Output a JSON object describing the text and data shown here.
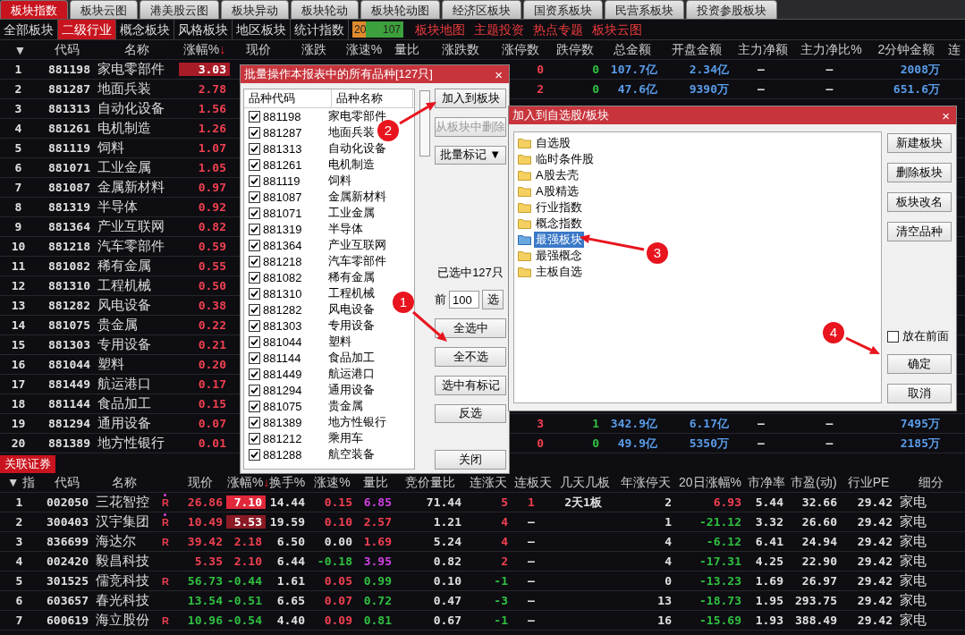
{
  "top_tabs": [
    {
      "label": "板块指数",
      "selected": true
    },
    {
      "label": "板块云图",
      "selected": false
    },
    {
      "label": "港美股云图",
      "selected": false
    },
    {
      "label": "板块异动",
      "selected": false
    },
    {
      "label": "板块轮动",
      "selected": false
    },
    {
      "label": "板块轮动图",
      "selected": false
    },
    {
      "label": "经济区板块",
      "selected": false
    },
    {
      "label": "国资系板块",
      "selected": false
    },
    {
      "label": "民营系板块",
      "selected": false
    },
    {
      "label": "投资参股板块",
      "selected": false
    }
  ],
  "sub_tabs": [
    {
      "label": "全部板块",
      "selected": false
    },
    {
      "label": "二级行业",
      "selected": true
    },
    {
      "label": "概念板块",
      "selected": false
    },
    {
      "label": "风格板块",
      "selected": false
    },
    {
      "label": "地区板块",
      "selected": false
    },
    {
      "label": "统计指数",
      "selected": false
    }
  ],
  "breadth": {
    "up": "20",
    "down": "107"
  },
  "links": [
    "板块地图",
    "主题投资",
    "热点专题",
    "板块云图"
  ],
  "sector_table": {
    "columns": [
      {
        "label": "▼",
        "sorted": false
      },
      {
        "label": "代码",
        "sorted": false
      },
      {
        "label": "名称",
        "sorted": false
      },
      {
        "label": "涨幅%",
        "sorted": true
      },
      {
        "label": "现价",
        "sorted": false
      },
      {
        "label": "涨跌",
        "sorted": false
      },
      {
        "label": "涨速%",
        "sorted": false
      },
      {
        "label": "量比",
        "sorted": false
      },
      {
        "label": "涨跌数",
        "sorted": false
      },
      {
        "label": "涨停数",
        "sorted": false
      },
      {
        "label": "跌停数",
        "sorted": false
      },
      {
        "label": "总金额",
        "sorted": false
      },
      {
        "label": "开盘金额",
        "sorted": false
      },
      {
        "label": "主力净额",
        "sorted": false
      },
      {
        "label": "主力净比%",
        "sorted": false
      },
      {
        "label": "2分钟金额",
        "sorted": false
      },
      {
        "label": "连",
        "sorted": false
      }
    ],
    "rows": [
      {
        "no": "1",
        "code": "881198",
        "name": "家电零部件",
        "change": "3.03",
        "highlight": true,
        "right": {
          "limit_up": "0",
          "limit_down": "0",
          "total": "107.7亿",
          "open": "2.34亿",
          "main_net": "–",
          "main_ratio": "–",
          "amount_2m": "2008万"
        }
      },
      {
        "no": "2",
        "code": "881287",
        "name": "地面兵装",
        "change": "2.78",
        "highlight": false,
        "right": {
          "limit_up": "2",
          "limit_down": "0",
          "total": "47.6亿",
          "open": "9390万",
          "main_net": "–",
          "main_ratio": "–",
          "amount_2m": "651.6万"
        }
      },
      {
        "no": "3",
        "code": "881313",
        "name": "自动化设备",
        "change": "1.56",
        "highlight": false
      },
      {
        "no": "4",
        "code": "881261",
        "name": "电机制造",
        "change": "1.26",
        "highlight": false
      },
      {
        "no": "5",
        "code": "881119",
        "name": "饲料",
        "change": "1.07",
        "highlight": false
      },
      {
        "no": "6",
        "code": "881071",
        "name": "工业金属",
        "change": "1.05",
        "highlight": false
      },
      {
        "no": "7",
        "code": "881087",
        "name": "金属新材料",
        "change": "0.97",
        "highlight": false
      },
      {
        "no": "8",
        "code": "881319",
        "name": "半导体",
        "change": "0.92",
        "highlight": false
      },
      {
        "no": "9",
        "code": "881364",
        "name": "产业互联网",
        "change": "0.82",
        "highlight": false
      },
      {
        "no": "10",
        "code": "881218",
        "name": "汽车零部件",
        "change": "0.59",
        "highlight": false
      },
      {
        "no": "11",
        "code": "881082",
        "name": "稀有金属",
        "change": "0.55",
        "highlight": false
      },
      {
        "no": "12",
        "code": "881310",
        "name": "工程机械",
        "change": "0.50",
        "highlight": false
      },
      {
        "no": "13",
        "code": "881282",
        "name": "风电设备",
        "change": "0.38",
        "highlight": false
      },
      {
        "no": "14",
        "code": "881075",
        "name": "贵金属",
        "change": "0.22",
        "highlight": false
      },
      {
        "no": "15",
        "code": "881303",
        "name": "专用设备",
        "change": "0.21",
        "highlight": false
      },
      {
        "no": "16",
        "code": "881044",
        "name": "塑料",
        "change": "0.20",
        "highlight": false
      },
      {
        "no": "17",
        "code": "881449",
        "name": "航运港口",
        "change": "0.17",
        "highlight": false
      },
      {
        "no": "18",
        "code": "881144",
        "name": "食品加工",
        "change": "0.15",
        "highlight": false
      },
      {
        "no": "19",
        "code": "881294",
        "name": "通用设备",
        "change": "0.07",
        "highlight": false,
        "right": {
          "limit_up": "3",
          "limit_down": "1",
          "total": "342.9亿",
          "open": "6.17亿",
          "main_net": "–",
          "main_ratio": "–",
          "amount_2m": "7495万"
        }
      },
      {
        "no": "20",
        "code": "881389",
        "name": "地方性银行",
        "change": "0.01",
        "highlight": false,
        "right": {
          "limit_up": "0",
          "limit_down": "0",
          "total": "49.9亿",
          "open": "5350万",
          "main_net": "–",
          "main_ratio": "–",
          "amount_2m": "2185万"
        }
      }
    ]
  },
  "related": {
    "tab": "关联证券",
    "columns": [
      {
        "label": "▼ 指",
        "sorted": false
      },
      {
        "label": "代码",
        "sorted": false
      },
      {
        "label": "名称",
        "sorted": false
      },
      {
        "label": "现价",
        "sorted": false
      },
      {
        "label": "涨幅%",
        "sorted": true
      },
      {
        "label": "换手%",
        "sorted": false
      },
      {
        "label": "涨速%",
        "sorted": false
      },
      {
        "label": "量比",
        "sorted": false
      },
      {
        "label": "竞价量比",
        "sorted": false
      },
      {
        "label": "连涨天",
        "sorted": false
      },
      {
        "label": "连板天",
        "sorted": false
      },
      {
        "label": "几天几板",
        "sorted": false
      },
      {
        "label": "年涨停天",
        "sorted": false
      },
      {
        "label": "20日涨幅%",
        "sorted": false
      },
      {
        "label": "市净率",
        "sorted": false
      },
      {
        "label": "市盈(动)",
        "sorted": false
      },
      {
        "label": "行业PE",
        "sorted": false
      },
      {
        "label": "细分",
        "sorted": false
      }
    ],
    "rows": [
      {
        "no": "1",
        "code": "002050",
        "name": "三花智控",
        "flag": "R",
        "marked": true,
        "price": "26.86",
        "change": "7.10",
        "highlight": true,
        "bright": true,
        "turnover": "14.44",
        "speed": "0.15",
        "vol_ratio": "6.85",
        "auction_ratio": "71.44",
        "up_days": "5",
        "board_days": "1",
        "days_boards": "2天1板",
        "limit_days": "2",
        "chg20": "6.93",
        "pb": "5.44",
        "pe": "32.66",
        "industry_pe": "29.42",
        "industry": "家电"
      },
      {
        "no": "2",
        "code": "300403",
        "name": "汉宇集团",
        "flag": "R",
        "marked": true,
        "price": "10.49",
        "change": "5.53",
        "highlight": true,
        "bright": false,
        "turnover": "19.59",
        "speed": "0.10",
        "vol_ratio": "2.57",
        "auction_ratio": "1.21",
        "up_days": "4",
        "board_days": "–",
        "limit_days": "1",
        "chg20": "-21.12",
        "pb": "3.32",
        "pe": "26.60",
        "industry_pe": "29.42",
        "industry": "家电"
      },
      {
        "no": "3",
        "code": "836699",
        "name": "海达尔",
        "flag": "R",
        "marked": false,
        "price": "39.42",
        "change": "2.18",
        "highlight": false,
        "turnover": "6.50",
        "speed": "0.00",
        "vol_ratio": "1.69",
        "auction_ratio": "5.24",
        "up_days": "4",
        "board_days": "–",
        "limit_days": "4",
        "chg20": "-6.12",
        "pb": "6.41",
        "pe": "24.94",
        "industry_pe": "29.42",
        "industry": "家电"
      },
      {
        "no": "4",
        "code": "002420",
        "name": "毅昌科技",
        "marked": false,
        "price": "5.35",
        "change": "2.10",
        "highlight": false,
        "turnover": "6.44",
        "speed": "-0.18",
        "vol_ratio": "3.95",
        "auction_ratio": "0.82",
        "up_days": "2",
        "board_days": "–",
        "limit_days": "4",
        "chg20": "-17.31",
        "pb": "4.25",
        "pe": "22.90",
        "industry_pe": "29.42",
        "industry": "家电"
      },
      {
        "no": "5",
        "code": "301525",
        "name": "儒竞科技",
        "flag": "R",
        "marked": false,
        "price": "56.73",
        "change": "-0.44",
        "highlight": false,
        "turnover": "1.61",
        "speed": "0.05",
        "vol_ratio": "0.99",
        "auction_ratio": "0.10",
        "up_days": "-1",
        "board_days": "–",
        "limit_days": "0",
        "chg20": "-13.23",
        "pb": "1.69",
        "pe": "26.97",
        "industry_pe": "29.42",
        "industry": "家电"
      },
      {
        "no": "6",
        "code": "603657",
        "name": "春光科技",
        "marked": false,
        "price": "13.54",
        "change": "-0.51",
        "highlight": false,
        "turnover": "6.65",
        "speed": "0.07",
        "vol_ratio": "0.72",
        "auction_ratio": "0.47",
        "up_days": "-3",
        "board_days": "–",
        "limit_days": "13",
        "chg20": "-18.73",
        "pb": "1.95",
        "pe": "293.75",
        "industry_pe": "29.42",
        "industry": "家电"
      },
      {
        "no": "7",
        "code": "600619",
        "name": "海立股份",
        "flag": "R",
        "marked": false,
        "price": "10.96",
        "change": "-0.54",
        "highlight": false,
        "turnover": "4.40",
        "speed": "0.09",
        "vol_ratio": "0.81",
        "auction_ratio": "0.67",
        "up_days": "-1",
        "board_days": "–",
        "limit_days": "16",
        "chg20": "-15.69",
        "pb": "1.93",
        "pe": "388.49",
        "industry_pe": "29.42",
        "industry": "家电"
      }
    ]
  },
  "batch_dialog": {
    "title": "批量操作本报表中的所有品种[127只]",
    "columns": [
      "品种代码",
      "品种名称"
    ],
    "items": [
      {
        "code": "881198",
        "name": "家电零部件",
        "checked": true
      },
      {
        "code": "881287",
        "name": "地面兵装",
        "checked": true
      },
      {
        "code": "881313",
        "name": "自动化设备",
        "checked": true
      },
      {
        "code": "881261",
        "name": "电机制造",
        "checked": true
      },
      {
        "code": "881119",
        "name": "饲料",
        "checked": true
      },
      {
        "code": "881087",
        "name": "金属新材料",
        "checked": true
      },
      {
        "code": "881071",
        "name": "工业金属",
        "checked": true
      },
      {
        "code": "881319",
        "name": "半导体",
        "checked": true
      },
      {
        "code": "881364",
        "name": "产业互联网",
        "checked": true
      },
      {
        "code": "881218",
        "name": "汽车零部件",
        "checked": true
      },
      {
        "code": "881082",
        "name": "稀有金属",
        "checked": true
      },
      {
        "code": "881310",
        "name": "工程机械",
        "checked": true
      },
      {
        "code": "881282",
        "name": "风电设备",
        "checked": true
      },
      {
        "code": "881303",
        "name": "专用设备",
        "checked": true
      },
      {
        "code": "881044",
        "name": "塑料",
        "checked": true
      },
      {
        "code": "881144",
        "name": "食品加工",
        "checked": true
      },
      {
        "code": "881449",
        "name": "航运港口",
        "checked": true
      },
      {
        "code": "881294",
        "name": "通用设备",
        "checked": true
      },
      {
        "code": "881075",
        "name": "贵金属",
        "checked": true
      },
      {
        "code": "881389",
        "name": "地方性银行",
        "checked": true
      },
      {
        "code": "881212",
        "name": "乘用车",
        "checked": true
      },
      {
        "code": "881288",
        "name": "航空装备",
        "checked": true
      }
    ],
    "actions_top": [
      {
        "label": "加入到板块",
        "disabled": false
      },
      {
        "label": "从板块中删除",
        "disabled": true
      },
      {
        "label": "批量标记 ▼",
        "disabled": false
      }
    ],
    "selected_count": "已选中127只",
    "top_n": {
      "label": "前",
      "value": "100",
      "button": "选"
    },
    "actions_bottom": [
      {
        "label": "全选中",
        "disabled": false
      },
      {
        "label": "全不选",
        "disabled": false
      },
      {
        "label": "选中有标记",
        "disabled": false
      },
      {
        "label": "反选",
        "disabled": false
      }
    ],
    "close": "关闭"
  },
  "add_dialog": {
    "title": "加入到自选股/板块",
    "folders": [
      {
        "label": "自选股",
        "selected": false
      },
      {
        "label": "临时条件股",
        "selected": false
      },
      {
        "label": "A股去壳",
        "selected": false
      },
      {
        "label": "A股精选",
        "selected": false
      },
      {
        "label": "行业指数",
        "selected": false
      },
      {
        "label": "概念指数",
        "selected": false
      },
      {
        "label": "最强板块",
        "selected": true
      },
      {
        "label": "最强概念",
        "selected": false
      },
      {
        "label": "主板自选",
        "selected": false
      }
    ],
    "actions": [
      "新建板块",
      "删除板块",
      "板块改名",
      "清空品种"
    ],
    "front": {
      "label": "放在前面",
      "checked": false
    },
    "ok": "确定",
    "cancel": "取消"
  },
  "callouts": [
    "1",
    "2",
    "3",
    "4"
  ],
  "sort_mark": "↓",
  "close_mark": "×",
  "close_mark_2": "×"
}
